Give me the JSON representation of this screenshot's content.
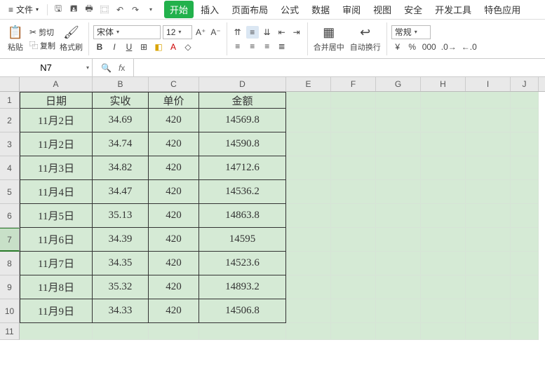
{
  "menu": {
    "file_label": "文件",
    "tabs": [
      "开始",
      "插入",
      "页面布局",
      "公式",
      "数据",
      "审阅",
      "视图",
      "安全",
      "开发工具",
      "特色应用"
    ],
    "active_tab_index": 0
  },
  "toolbar": {
    "paste": "粘贴",
    "cut": "剪切",
    "copy": "复制",
    "format_painter": "格式刷",
    "font_name": "宋体",
    "font_size": "12",
    "merge_center": "合并居中",
    "wrap_text": "自动换行",
    "number_format": "常规"
  },
  "namebox": "N7",
  "formula": "",
  "columns": [
    "A",
    "B",
    "C",
    "D",
    "E",
    "F",
    "G",
    "H",
    "I",
    "J"
  ],
  "row_count": 11,
  "selected_row": 7,
  "colwidths": [
    "cA",
    "cB",
    "cC",
    "cD",
    "cE",
    "cF",
    "cG",
    "cH",
    "cI",
    "cJ"
  ],
  "data": {
    "headers": [
      "日期",
      "实收",
      "单价",
      "金额"
    ],
    "rows": [
      [
        "11月2日",
        "34.69",
        "420",
        "14569.8"
      ],
      [
        "11月2日",
        "34.74",
        "420",
        "14590.8"
      ],
      [
        "11月3日",
        "34.82",
        "420",
        "14712.6"
      ],
      [
        "11月4日",
        "34.47",
        "420",
        "14536.2"
      ],
      [
        "11月5日",
        "35.13",
        "420",
        "14863.8"
      ],
      [
        "11月6日",
        "34.39",
        "420",
        "14595"
      ],
      [
        "11月7日",
        "34.35",
        "420",
        "14523.6"
      ],
      [
        "11月8日",
        "35.32",
        "420",
        "14893.2"
      ],
      [
        "11月9日",
        "34.33",
        "420",
        "14506.8"
      ]
    ]
  }
}
